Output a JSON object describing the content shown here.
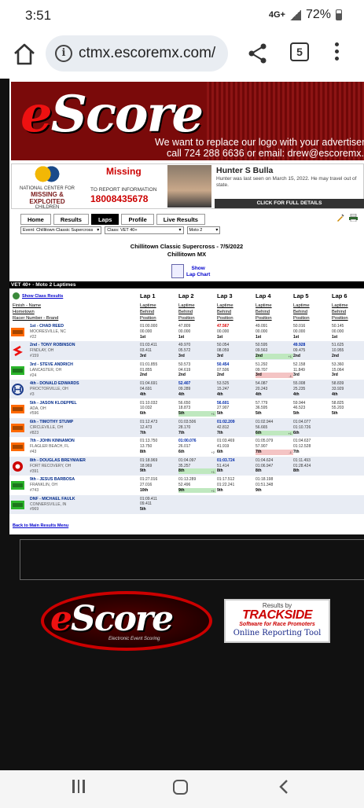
{
  "status_bar": {
    "time": "3:51",
    "network": "4G+",
    "battery": "72%"
  },
  "browser": {
    "url": "ctmx.escoremx.com/",
    "tab_count": "5"
  },
  "banner": {
    "logo": "eScore",
    "logo_sub": "Electronic",
    "line1": "We want to replace our logo with your advertisement!",
    "line2": "call 724 288 6636  or email: drew@escoremx.com"
  },
  "missing_ad": {
    "org_top": "NATIONAL CENTER FOR",
    "org_name": "MISSING & EXPLOITED",
    "org_bottom": "CHILDREN",
    "title": "Missing",
    "report_label": "TO REPORT INFORMATION",
    "phone": "18008435678",
    "name": "Hunter S Bulla",
    "description": "Hunter was last seen on March 15, 2022.  He may travel out of state.",
    "details_label": "CLICK FOR FULL DETAILS"
  },
  "nav_tabs": [
    {
      "label": "Home",
      "active": false
    },
    {
      "label": "Results",
      "active": false
    },
    {
      "label": "Laps",
      "active": true
    },
    {
      "label": "Profile",
      "active": false
    },
    {
      "label": "Live Results",
      "active": false
    }
  ],
  "selects": {
    "event": "Event: Chillitown Classic Supercross",
    "class": "Class: VET 40+",
    "moto": "Moto 2"
  },
  "event": {
    "title": "Chillitown Classic Supercross - 7/5/2022",
    "venue": "Chillitown MX"
  },
  "lap_chart": {
    "line1": "Show",
    "line2": "Lap Chart"
  },
  "section_title": "VET 40+ - Moto 2 Laptimes",
  "show_class_results": "Show Class Results",
  "header_left": [
    "Finish - Name",
    "Hometown",
    "Racer Number - Brand"
  ],
  "lap_sub": [
    "Laptime",
    "Behind",
    "Position"
  ],
  "laps": [
    "Lap 1",
    "Lap 2",
    "Lap 3",
    "Lap 4",
    "Lap 5",
    "Lap 6"
  ],
  "riders": [
    {
      "finish": "1st - CHAD REED",
      "town": "MOORESVILLE, NC",
      "num": "#22",
      "brand": "ktm",
      "laps": [
        [
          "01:00.000",
          "00.000",
          "1st",
          "",
          ""
        ],
        [
          "47.809",
          "00.000",
          "1st",
          "",
          ""
        ],
        [
          "47.567",
          "00.000",
          "1st",
          "red",
          ""
        ],
        [
          "49.091",
          "00.000",
          "1st",
          "",
          ""
        ],
        [
          "50.016",
          "00.000",
          "1st",
          "",
          ""
        ],
        [
          "50.145",
          "00.000",
          "1st",
          "",
          ""
        ]
      ]
    },
    {
      "finish": "2nd - TONY ROBINSON",
      "town": "FINDLAY, OH",
      "num": "#159",
      "brand": "suzuki",
      "laps": [
        [
          "01:03.411",
          "03.411",
          "3rd",
          "",
          ""
        ],
        [
          "49.970",
          "05.572",
          "3rd",
          "",
          ""
        ],
        [
          "50.054",
          "08.059",
          "3rd",
          "",
          ""
        ],
        [
          "50.595",
          "09.563",
          "2nd",
          "gain",
          "+1"
        ],
        [
          "49.928",
          "09.475",
          "2nd",
          "best",
          ""
        ],
        [
          "51.625",
          "10.955",
          "2nd",
          "",
          ""
        ]
      ]
    },
    {
      "finish": "3rd - STEVE ANDRICH",
      "town": "LANCASTER, OH",
      "num": "#24",
      "brand": "kawasaki",
      "laps": [
        [
          "01:01.855",
          "01.855",
          "2nd",
          "",
          ""
        ],
        [
          "50.573",
          "04.619",
          "2nd",
          "",
          ""
        ],
        [
          "50.454",
          "07.506",
          "2nd",
          "best",
          ""
        ],
        [
          "51.292",
          "09.707",
          "3rd",
          "loss",
          "-1"
        ],
        [
          "52.158",
          "11.849",
          "3rd",
          "",
          ""
        ],
        [
          "53.360",
          "15.064",
          "3rd",
          "",
          ""
        ]
      ]
    },
    {
      "finish": "4th - DONALD EDWARDS",
      "town": "PROCTORVILLE, OH",
      "num": "#3",
      "brand": "husqvarna",
      "laps": [
        [
          "01:04.691",
          "04.691",
          "4th",
          "",
          ""
        ],
        [
          "52.407",
          "09.289",
          "4th",
          "best",
          ""
        ],
        [
          "53.525",
          "15.247",
          "4th",
          "",
          ""
        ],
        [
          "54.087",
          "20.243",
          "4th",
          "",
          ""
        ],
        [
          "55.008",
          "25.235",
          "4th",
          "",
          ""
        ],
        [
          "58.839",
          "33.929",
          "4th",
          "",
          ""
        ]
      ]
    },
    {
      "finish": "5th - JASON KLOEPPEL",
      "town": "ADA, OH",
      "num": "#596",
      "brand": "ktm",
      "laps": [
        [
          "01:10.032",
          "10.032",
          "6th",
          "",
          ""
        ],
        [
          "56.650",
          "18.873",
          "5th",
          "gain",
          "+1"
        ],
        [
          "56.601",
          "27.907",
          "5th",
          "best",
          ""
        ],
        [
          "57.779",
          "36.595",
          "5th",
          "",
          ""
        ],
        [
          "59.944",
          "46.523",
          "5th",
          "",
          ""
        ],
        [
          "58.825",
          "55.203",
          "5th",
          "",
          ""
        ]
      ]
    },
    {
      "finish": "6th - TIMOTHY STUMP",
      "town": "CIRCLEVILLE, OH",
      "num": "#823",
      "brand": "ktm",
      "laps": [
        [
          "01:12.473",
          "12.473",
          "7th",
          "",
          ""
        ],
        [
          "01:03.506",
          "28.170",
          "7th",
          "",
          ""
        ],
        [
          "01:02.209",
          "42.812",
          "7th",
          "best",
          ""
        ],
        [
          "01:02.944",
          "56.665",
          "6th",
          "gain",
          "+1"
        ],
        [
          "01:04.077",
          "01:10.726",
          "6th",
          "",
          ""
        ],
        [
          "",
          "",
          "",
          "",
          ""
        ]
      ]
    },
    {
      "finish": "7th - JOHN KINNAMON",
      "town": "FLAGLER BEACH, FL",
      "num": "#43",
      "brand": "ktm",
      "laps": [
        [
          "01:13.750",
          "13.750",
          "8th",
          "",
          ""
        ],
        [
          "01:00.076",
          "26.017",
          "6th",
          "best",
          "+2"
        ],
        [
          "01:03.469",
          "41.919",
          "6th",
          "",
          ""
        ],
        [
          "01:05.079",
          "57.907",
          "7th",
          "loss",
          "-1"
        ],
        [
          "01:04.637",
          "01:12.528",
          "7th",
          "",
          ""
        ],
        [
          "",
          "",
          "",
          "",
          ""
        ]
      ]
    },
    {
      "finish": "8th - DOUGLAS BREYMAIER",
      "town": "FORT RECOVERY, OH",
      "num": "#391",
      "brand": "gasgas",
      "laps": [
        [
          "01:18.969",
          "18.969",
          "9th",
          "",
          ""
        ],
        [
          "01:04.097",
          "35.257",
          "8th",
          "gain",
          "+1"
        ],
        [
          "01:03.724",
          "51.414",
          "8th",
          "best",
          ""
        ],
        [
          "01:04.624",
          "01:06.947",
          "8th",
          "",
          ""
        ],
        [
          "01:11.493",
          "01:28.424",
          "8th",
          "",
          ""
        ],
        [
          "",
          "",
          "",
          "",
          ""
        ]
      ]
    },
    {
      "finish": "9th - JESUS BARBOSA",
      "town": "FRANKLIN, OH",
      "num": "#743",
      "brand": "kawasaki",
      "laps": [
        [
          "01:27.016",
          "27.016",
          "10th",
          "",
          ""
        ],
        [
          "01:13.289",
          "52.496",
          "9th",
          "gain",
          "+1"
        ],
        [
          "01:17.512",
          "01:22.241",
          "9th",
          "",
          ""
        ],
        [
          "01:18.198",
          "01:51.348",
          "9th",
          "",
          ""
        ],
        [
          "",
          "",
          "",
          "",
          ""
        ],
        [
          "",
          "",
          "",
          "",
          ""
        ]
      ]
    },
    {
      "finish": "DNF - MICHAEL FAULK",
      "town": "CONNERSVILLE, IN",
      "num": "#969",
      "brand": "kawasaki",
      "laps": [
        [
          "01:09.411",
          "09.411",
          "5th",
          "",
          ""
        ],
        [
          "",
          "",
          "",
          "",
          ""
        ],
        [
          "",
          "",
          "",
          "",
          ""
        ],
        [
          "",
          "",
          "",
          "",
          ""
        ],
        [
          "",
          "",
          "",
          "",
          ""
        ],
        [
          "",
          "",
          "",
          "",
          ""
        ]
      ]
    }
  ],
  "back_link": "Back to Main Results Menu",
  "footer": {
    "escore_logo": "eScore",
    "escore_tag": "Electronic Event Scoring",
    "ts_line1": "Results by",
    "ts_name": "TRACKSIDE",
    "ts_tag": "Software for Race Promoters",
    "ts_url": "www.tracksidesoftware.com",
    "ts_tool": "Online Reporting Tool"
  },
  "colors": {
    "banner": "#7a0a0a",
    "best_lap": "#002aaa",
    "gain": "#bfe8bf",
    "loss": "#f4c4c4",
    "active_tab": "#000000"
  }
}
